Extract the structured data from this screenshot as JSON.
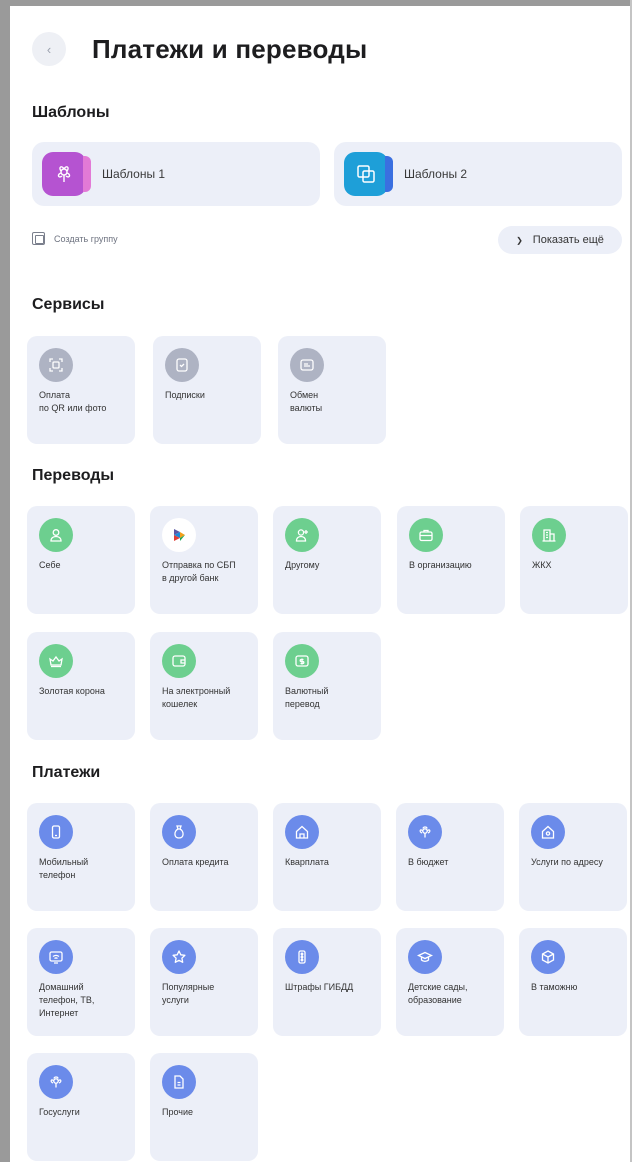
{
  "header": {
    "title": "Платежи и переводы"
  },
  "templates": {
    "title": "Шаблоны",
    "items": [
      {
        "label": "Шаблоны 1",
        "icon": "flower-icon",
        "color": "#b553d1"
      },
      {
        "label": "Шаблоны 2",
        "icon": "squares-icon",
        "color": "#1e9fd8"
      }
    ],
    "create_group": "Создать группу",
    "show_more": "Показать ещё"
  },
  "services": {
    "title": "Сервисы",
    "items": [
      {
        "label": "Оплата\nпо QR или фото",
        "icon": "qr-scan-icon"
      },
      {
        "label": "Подписки",
        "icon": "subscription-icon"
      },
      {
        "label": "Обмен\nвалюты",
        "icon": "currency-exchange-icon"
      }
    ]
  },
  "transfers": {
    "title": "Переводы",
    "items": [
      {
        "label": "Себе",
        "icon": "person-icon"
      },
      {
        "label": "Отправка по СБП\nв другой банк",
        "icon": "sbp-logo-icon"
      },
      {
        "label": "Другому",
        "icon": "person-add-icon"
      },
      {
        "label": "В организацию",
        "icon": "briefcase-icon"
      },
      {
        "label": "ЖКХ",
        "icon": "building-icon"
      },
      {
        "label": "Золотая корона",
        "icon": "crown-icon"
      },
      {
        "label": "На электронный\nкошелек",
        "icon": "wallet-icon"
      },
      {
        "label": "Валютный\nперевод",
        "icon": "dollar-wallet-icon"
      }
    ]
  },
  "payments": {
    "title": "Платежи",
    "items": [
      {
        "label": "Мобильный\nтелефон",
        "icon": "phone-icon"
      },
      {
        "label": "Оплата кредита",
        "icon": "money-bag-icon"
      },
      {
        "label": "Кварплата",
        "icon": "house-icon"
      },
      {
        "label": "В бюджет",
        "icon": "emblem-icon"
      },
      {
        "label": "Услуги по адресу",
        "icon": "house-location-icon"
      },
      {
        "label": "Домашний\nтелефон, ТВ,\nИнтернет",
        "icon": "tv-icon"
      },
      {
        "label": "Популярные\nуслуги",
        "icon": "star-icon"
      },
      {
        "label": "Штрафы ГИБДД",
        "icon": "traffic-light-icon"
      },
      {
        "label": "Детские сады,\nобразование",
        "icon": "graduation-cap-icon"
      },
      {
        "label": "В таможню",
        "icon": "box-icon"
      },
      {
        "label": "Госуслуги",
        "icon": "emblem-icon"
      },
      {
        "label": "Прочие",
        "icon": "document-icon"
      }
    ]
  }
}
